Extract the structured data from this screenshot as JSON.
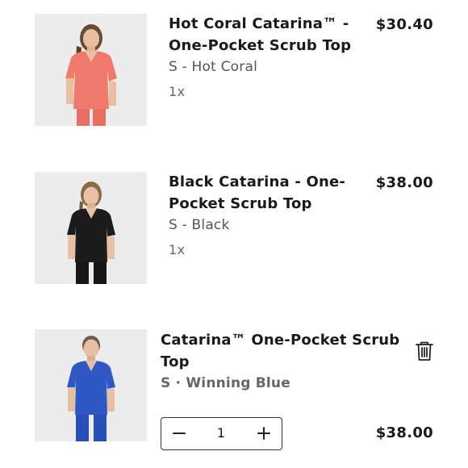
{
  "cart": {
    "items": [
      {
        "title_line1": "Hot Coral Catarina™ -",
        "title_line2": "One-Pocket Scrub Top",
        "variant": "S - Hot Coral",
        "quantity_text": "1x",
        "price": "$30.40",
        "image_icon": "product-photo-coral-scrub",
        "color": "#f07a6c"
      },
      {
        "title_line1": "Black Catarina - One-",
        "title_line2": "Pocket Scrub Top",
        "variant": "S - Black",
        "quantity_text": "1x",
        "price": "$38.00",
        "image_icon": "product-photo-black-scrub",
        "color": "#1c1c1c"
      },
      {
        "title_line1": "Catarina™ One-Pocket Scrub",
        "title_line2": "Top",
        "variant": "S · Winning Blue",
        "quantity_value": "1",
        "price": "$38.00",
        "image_icon": "product-photo-blue-scrub",
        "color": "#2f58c4",
        "remove_icon": "trash-icon",
        "decrease_icon": "minus-icon",
        "increase_icon": "plus-icon"
      }
    ]
  }
}
